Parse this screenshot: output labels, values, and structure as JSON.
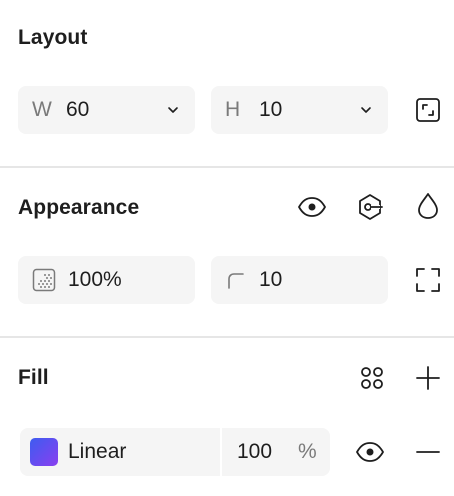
{
  "layout": {
    "title": "Layout",
    "width": {
      "prefix": "W",
      "value": "60"
    },
    "height": {
      "prefix": "H",
      "value": "10"
    },
    "icons": {
      "chevron": "chevron-down-icon",
      "resize": "resize-to-fit-icon"
    }
  },
  "appearance": {
    "title": "Appearance",
    "opacity": "100%",
    "corner_radius": "10",
    "icons": [
      "eye-icon",
      "component-variant-icon",
      "droplet-icon",
      "expand-corners-icon"
    ]
  },
  "fill": {
    "title": "Fill",
    "type": "Linear",
    "opacity": "100",
    "opacity_unit": "%",
    "gradient_colors": [
      "#3d5cf0",
      "#8a3ff0"
    ],
    "icons": [
      "styles-grid-icon",
      "plus-icon",
      "eye-icon",
      "minus-icon"
    ]
  }
}
